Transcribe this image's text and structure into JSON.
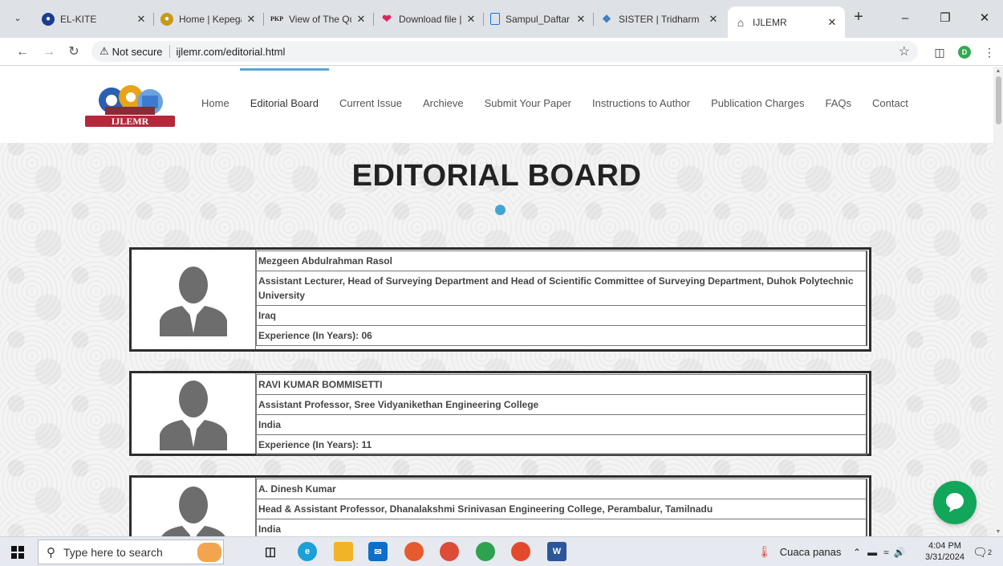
{
  "browser": {
    "tabs": [
      {
        "title": "EL-KITE",
        "icon": "globe-icon",
        "color": "#1a3d8f"
      },
      {
        "title": "Home | Kepegaw",
        "icon": "kepegawaian-icon",
        "color": "#c79a1a"
      },
      {
        "title": "View of The Qua",
        "icon": "pkp-icon",
        "color": "#222222"
      },
      {
        "title": "Download file |",
        "icon": "heart-icon",
        "color": "#e0245e"
      },
      {
        "title": "Sampul_Daftar h",
        "icon": "document-icon",
        "color": "#1a73e8"
      },
      {
        "title": "SISTER | Tridharm",
        "icon": "sister-icon",
        "color": "#3a78c2"
      },
      {
        "title": "IJLEMR",
        "icon": "pillar-icon",
        "color": "#333333"
      }
    ],
    "security_label": "Not secure",
    "url": "ijlemr.com/editorial.html",
    "profile_initial": "D"
  },
  "site": {
    "logo_text": "IJLEMR",
    "nav": [
      "Home",
      "Editorial Board",
      "Current Issue",
      "Archieve",
      "Submit Your Paper",
      "Instructions to Author",
      "Publication Charges",
      "FAQs",
      "Contact"
    ],
    "active_nav": "Editorial Board",
    "page_title": "EDITORIAL BOARD",
    "accent_color": "#43a4d4"
  },
  "members": [
    {
      "name": "Mezgeen Abdulrahman Rasol",
      "position": "Assistant Lecturer, Head of Surveying Department and Head of Scientific Committee of Surveying Department, Duhok Polytechnic University",
      "country": "Iraq",
      "experience": "Experience (In Years): 06"
    },
    {
      "name": "RAVI KUMAR BOMMISETTI",
      "position": "Assistant Professor, Sree Vidyanikethan Engineering College",
      "country": "India",
      "experience": "Experience (In Years): 11"
    },
    {
      "name": "A. Dinesh Kumar",
      "position": "Head & Assistant Professor, Dhanalakshmi Srinivasan Engineering College, Perambalur, Tamilnadu",
      "country": "India",
      "experience": ""
    }
  ],
  "taskbar": {
    "search_placeholder": "Type here to search",
    "weather": "Cuaca panas",
    "time": "4:04 PM",
    "date": "3/31/2024",
    "notification_count": "2"
  }
}
